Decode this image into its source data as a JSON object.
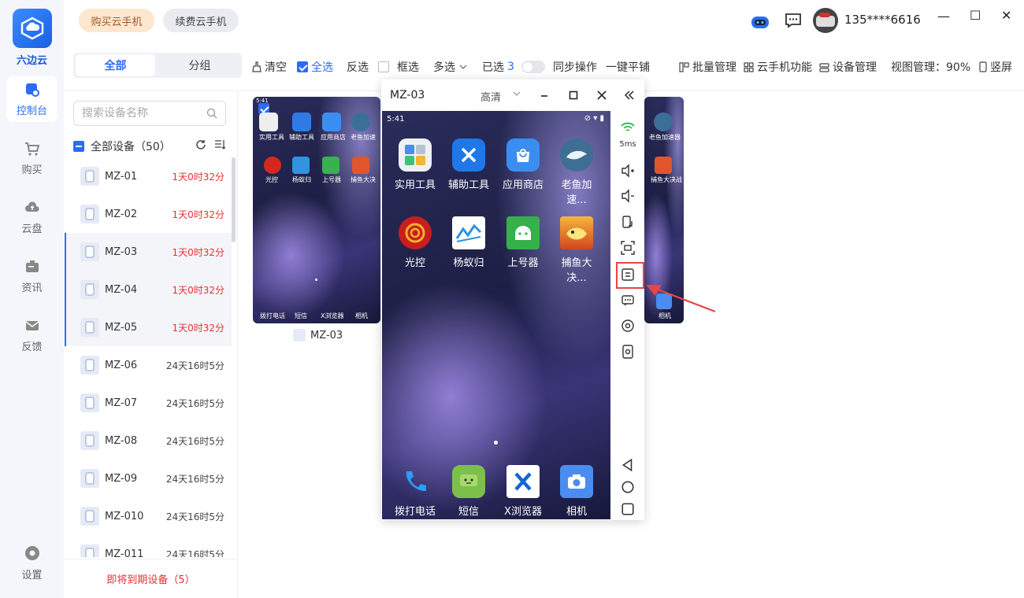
{
  "app": {
    "name": "六边云",
    "brand_color": "#2b6cf6"
  },
  "nav": [
    {
      "label": "控制台",
      "icon": "dashboard-icon",
      "active": true
    },
    {
      "label": "购买",
      "icon": "cart-icon"
    },
    {
      "label": "云盘",
      "icon": "cloud-disk-icon"
    },
    {
      "label": "资讯",
      "icon": "news-icon"
    },
    {
      "label": "反馈",
      "icon": "feedback-icon"
    },
    {
      "label": "设置",
      "icon": "gear-icon"
    }
  ],
  "topbar": {
    "buy_label": "购买云手机",
    "renew_label": "续费云手机",
    "username": "135****6616",
    "window": {
      "minimize": "—",
      "maximize": "☐",
      "close": "✕"
    }
  },
  "tabs": [
    {
      "label": "全部"
    },
    {
      "label": "分组"
    }
  ],
  "toolbar": {
    "clear": "清空",
    "select_all": "全选",
    "invert": "反选",
    "box_select": "框选",
    "multi_select": "多选",
    "selected_prefix": "已选",
    "selected_count": "3",
    "sync": "同步操作",
    "tile": "一键平铺",
    "batch": "批量管理",
    "cloud_func": "云手机功能",
    "device_mgmt": "设备管理",
    "view_zoom": "视图管理：90%",
    "portrait": "竖屏"
  },
  "device_panel": {
    "search_placeholder": "搜索设备名称",
    "all_devices": "全部设备（50）",
    "expiring": "即将到期设备（5）"
  },
  "devices": [
    {
      "name": "MZ-01",
      "time": "1天0时32分",
      "warn": true,
      "selected": false
    },
    {
      "name": "MZ-02",
      "time": "1天0时32分",
      "warn": true,
      "selected": false
    },
    {
      "name": "MZ-03",
      "time": "1天0时32分",
      "warn": true,
      "selected": true
    },
    {
      "name": "MZ-04",
      "time": "1天0时32分",
      "warn": true,
      "selected": true
    },
    {
      "name": "MZ-05",
      "time": "1天0时32分",
      "warn": true,
      "selected": true
    },
    {
      "name": "MZ-06",
      "time": "24天16时5分",
      "warn": false,
      "selected": false
    },
    {
      "name": "MZ-07",
      "time": "24天16时5分",
      "warn": false,
      "selected": false
    },
    {
      "name": "MZ-08",
      "time": "24天16时5分",
      "warn": false,
      "selected": false
    },
    {
      "name": "MZ-09",
      "time": "24天16时5分",
      "warn": false,
      "selected": false
    },
    {
      "name": "MZ-010",
      "time": "24天16时5分",
      "warn": false,
      "selected": false
    },
    {
      "name": "MZ-011",
      "time": "24天16时5分",
      "warn": false,
      "selected": false
    }
  ],
  "thumbnail": {
    "label": "MZ-03",
    "time": "5:41",
    "apps_top": [
      "实用工具",
      "辅助工具",
      "应用商店",
      "老鱼加速"
    ],
    "apps_mid": [
      "光控",
      "杨蚁归",
      "上号器",
      "捕鱼大决"
    ],
    "dock": [
      "拨打电话",
      "短信",
      "X浏览器",
      "相机"
    ],
    "right_top": [
      "老鱼加速器",
      "捕鱼大决战"
    ],
    "right_dock": "相机"
  },
  "float_window": {
    "title": "MZ-03",
    "quality": "高清",
    "latency": "5ms",
    "status_time": "5:41",
    "apps_row1": [
      "实用工具",
      "辅助工具",
      "应用商店",
      "老鱼加速..."
    ],
    "apps_row2": [
      "光控",
      "杨蚁归",
      "上号器",
      "捕鱼大决..."
    ],
    "dock": [
      "拨打电话",
      "短信",
      "X浏览器",
      "相机"
    ]
  }
}
